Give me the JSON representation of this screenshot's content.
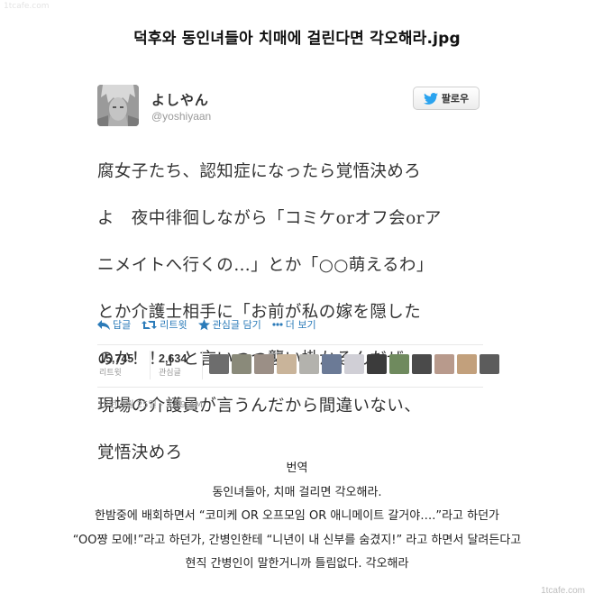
{
  "watermark_top": "1tcafe.com",
  "watermark_bottom": "1tcafe.com",
  "post_title": "덕후와 동인녀들아 치매에 걸린다면 각오해라.jpg",
  "tweet": {
    "author_name": "よしやん",
    "author_handle": "@yoshiyaan",
    "follow_label": "팔로우",
    "text_lines": [
      "腐女子たち、認知症になったら覚悟決めろ",
      "よ　夜中徘徊しながら「コミケorオフ会orア",
      "ニメイトへ行くの…」とか「○○萌えるわ」",
      "とか介護士相手に「お前が私の嫁を隠した",
      "のか！！」と言いつつ襲い掛かるんだぜ",
      "現場の介護員が言うんだから間違いない、",
      "覚悟決めろ"
    ],
    "actions": {
      "reply": "답글",
      "retweet": "리트윗",
      "favorite": "관심글 담기",
      "more": "더 보기"
    },
    "stats": {
      "retweets_count": "15,745",
      "retweets_label": "리트윗",
      "favorites_count": "2,634",
      "favorites_label": "관심글"
    },
    "face_colors": [
      "#6d6d6d",
      "#8a8a7a",
      "#9b8f86",
      "#c9b49a",
      "#b3b2ad",
      "#6b7a96",
      "#d0cfd6",
      "#3b3b3b",
      "#6f8a5e",
      "#4a4a4a",
      "#b89a8c",
      "#c2a07c",
      "#5c5c5c"
    ],
    "timestamp": "12년 5월 25일 - 3:29 AM"
  },
  "translation": {
    "heading": "번역",
    "lines": [
      "동인녀들아, 치매 걸리면 각오해라.",
      "한밤중에 배회하면서 “코미케 OR 오프모임 OR 애니메이트 갈거야….”라고 하던가",
      "“OO쨩 모에!”라고 하던가, 간병인한테 “니년이 내 신부를 숨겼지!” 라고 하면서 달려든다고",
      "현직 간병인이 말한거니까 틀림없다. 각오해라"
    ]
  },
  "colors": {
    "link_blue": "#2b7bb9",
    "twitter_bird": "#2aa3ef"
  }
}
